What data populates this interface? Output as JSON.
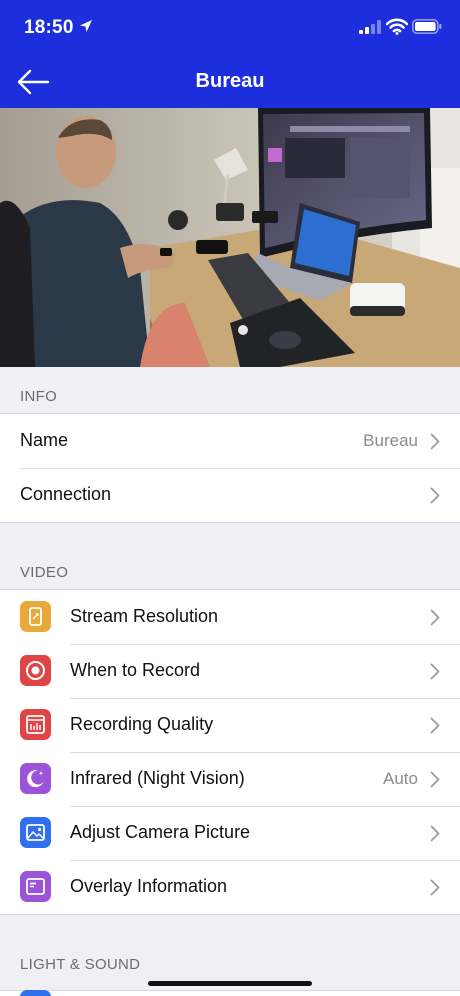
{
  "status_bar": {
    "time": "18:50"
  },
  "nav": {
    "title": "Bureau"
  },
  "sections": {
    "info": {
      "header": "INFO",
      "rows": [
        {
          "label": "Name",
          "value": "Bureau"
        },
        {
          "label": "Connection",
          "value": ""
        }
      ]
    },
    "video": {
      "header": "VIDEO",
      "rows": [
        {
          "label": "Stream Resolution",
          "value": "",
          "icon": "stream-resolution-icon",
          "color": "#e9a93a"
        },
        {
          "label": "When to Record",
          "value": "",
          "icon": "record-icon",
          "color": "#e04444"
        },
        {
          "label": "Recording Quality",
          "value": "",
          "icon": "recording-quality-icon",
          "color": "#e04444"
        },
        {
          "label": "Infrared (Night Vision)",
          "value": "Auto",
          "icon": "moon-icon",
          "color": "#9b54d8"
        },
        {
          "label": "Adjust Camera Picture",
          "value": "",
          "icon": "picture-icon",
          "color": "#2f6ff0"
        },
        {
          "label": "Overlay Information",
          "value": "",
          "icon": "overlay-icon",
          "color": "#9b54d8"
        }
      ]
    },
    "light_sound": {
      "header": "LIGHT & SOUND"
    }
  },
  "colors": {
    "nav_bar": "#1d2fdc",
    "background": "#efeff4"
  }
}
